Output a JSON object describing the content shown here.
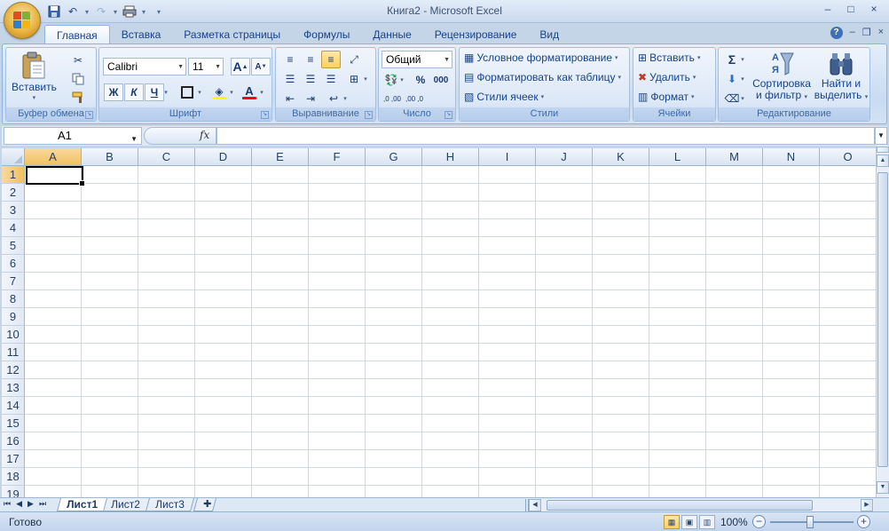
{
  "window": {
    "title": "Книга2 - Microsoft Excel",
    "minimize": "–",
    "maximize": "□",
    "close": "×",
    "inner_minimize": "–",
    "inner_restore": "❐",
    "inner_close": "×",
    "help": "?"
  },
  "qat": {
    "save_icon": "💾",
    "undo": "↶",
    "redo": "↷",
    "print": "⎙",
    "more": "▾"
  },
  "tabs": [
    {
      "label": "Главная"
    },
    {
      "label": "Вставка"
    },
    {
      "label": "Разметка страницы"
    },
    {
      "label": "Формулы"
    },
    {
      "label": "Данные"
    },
    {
      "label": "Рецензирование"
    },
    {
      "label": "Вид"
    }
  ],
  "groups": {
    "clipboard": {
      "label": "Буфер обмена",
      "paste": "Вставить"
    },
    "font": {
      "label": "Шрифт",
      "font_name": "Calibri",
      "font_size": "11",
      "bold": "Ж",
      "italic": "К",
      "underline": "Ч",
      "grow": "A",
      "shrink": "A"
    },
    "alignment": {
      "label": "Выравнивание"
    },
    "number": {
      "label": "Число",
      "format": "Общий",
      "percent": "%",
      "thousands": "000",
      "inc_dec": ",0 ,00",
      "dec_dec": ",00 ,0"
    },
    "styles": {
      "label": "Стили",
      "conditional": "Условное форматирование",
      "as_table": "Форматировать как таблицу",
      "cell_styles": "Стили ячеек"
    },
    "cells": {
      "label": "Ячейки",
      "insert": "Вставить",
      "delete": "Удалить",
      "format": "Формат"
    },
    "editing": {
      "label": "Редактирование",
      "sort_1": "Сортировка",
      "sort_2": "и фильтр",
      "find_1": "Найти и",
      "find_2": "выделить",
      "sigma": "Σ"
    }
  },
  "formula_bar": {
    "name_box": "A1",
    "fx": "fx",
    "formula": ""
  },
  "grid": {
    "columns": [
      "A",
      "B",
      "C",
      "D",
      "E",
      "F",
      "G",
      "H",
      "I",
      "J",
      "K",
      "L",
      "M",
      "N",
      "O"
    ],
    "rows": [
      "1",
      "2",
      "3",
      "4",
      "5",
      "6",
      "7",
      "8",
      "9",
      "10",
      "11",
      "12",
      "13",
      "14",
      "15",
      "16",
      "17",
      "18",
      "19"
    ],
    "active_col": "A",
    "active_row": "1"
  },
  "sheets": [
    {
      "label": "Лист1",
      "active": true
    },
    {
      "label": "Лист2",
      "active": false
    },
    {
      "label": "Лист3",
      "active": false
    }
  ],
  "status": {
    "text": "Готово",
    "zoom": "100%",
    "zoom_minus": "−",
    "zoom_plus": "+"
  },
  "colors": {
    "accent": "#15428b",
    "ribbon_bg": "#dce8f7",
    "active_header": "#f1c15f"
  }
}
